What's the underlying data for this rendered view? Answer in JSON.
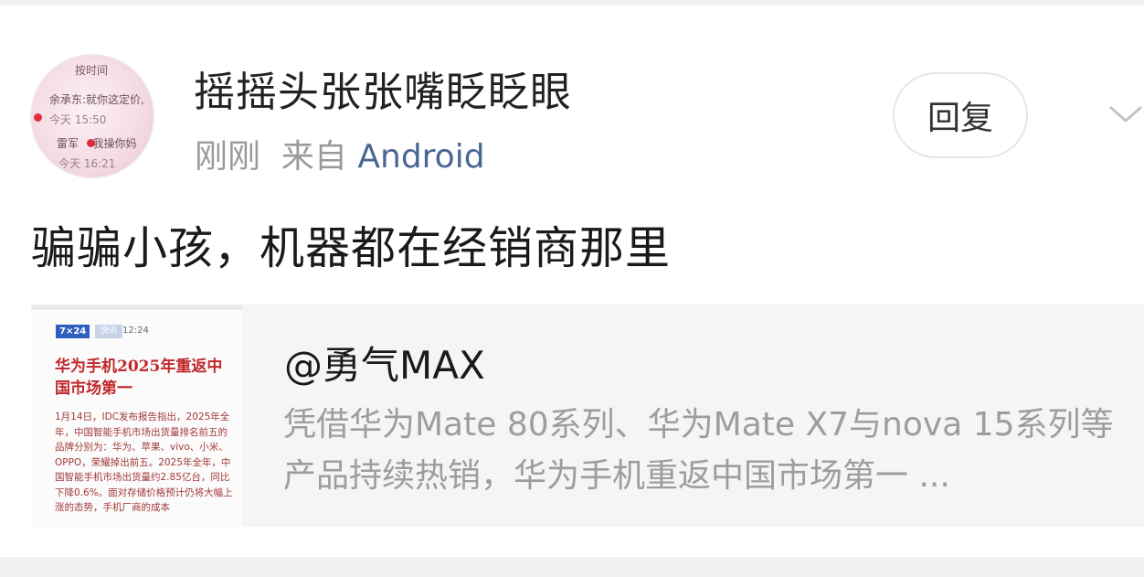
{
  "post": {
    "author": "摇摇头张张嘴眨眨眼",
    "time": "刚刚",
    "source_prefix": "来自",
    "source": "Android",
    "reply_label": "回复",
    "text": "骗骗小孩，机器都在经销商那里"
  },
  "avatar": {
    "line1": "按时间",
    "line2": "余承东:就你这定价,",
    "line3": "今天 15:50",
    "line4": "雷军",
    "line4b": ":我操你妈",
    "line5": "今天 16:21"
  },
  "repost": {
    "author": "@勇气MAX",
    "summary": "凭借华为Mate 80系列、华为Mate X7与nova 15系列等产品持续热销，华为手机重返中国市场第一 ...",
    "thumb": {
      "tag": "7×24",
      "tag2": "快讯",
      "time": "12:24",
      "headline": "华为手机2025年重返中国市场第一",
      "body": "1月14日，IDC发布报告指出，2025年全年，中国智能手机市场出货量排名前五的品牌分别为：华为、苹果、vivo、小米、OPPO，荣耀掉出前五。2025年全年，中国智能手机市场出货量约2.85亿台，同比下降0.6%。面对存储价格预计仍将大幅上涨的态势，手机厂商的成本"
    }
  },
  "colors": {
    "source_link": "#4b6694",
    "thumb_headline": "#c0282b"
  },
  "icons": {
    "more": "chevron-down-icon"
  }
}
